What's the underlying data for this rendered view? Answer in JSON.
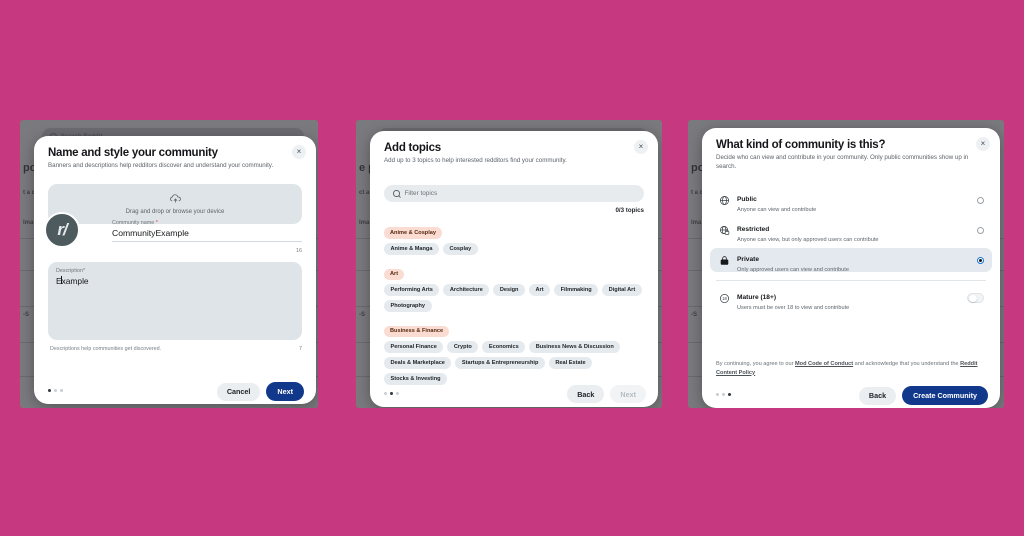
{
  "background_color": "#c6387f",
  "page_background": {
    "search_placeholder": "Search Reddit",
    "fragments": [
      "pc",
      "t a c",
      "Ima",
      "-S"
    ],
    "fragments_p2": [
      "e po",
      "ct a c",
      "Ima",
      "-S"
    ],
    "fragments_p3": [
      "po",
      "t a c",
      "Ima",
      "-S"
    ]
  },
  "panel1": {
    "title": "Name and style your community",
    "subtitle": "Banners and descriptions help redditors discover and understand your community.",
    "close_label": "×",
    "upload": {
      "icon": "upload-cloud-icon",
      "label": "Drag and drop or browse your device"
    },
    "avatar_text": "r/",
    "name_field": {
      "label": "Community name",
      "required_mark": "*",
      "value": "CommunityExample",
      "counter": "16"
    },
    "description_field": {
      "label": "Description",
      "required_mark": "*",
      "value": "Example",
      "counter": "7",
      "helper": "Descriptions help communities get discovered."
    },
    "footer": {
      "cancel_label": "Cancel",
      "next_label": "Next",
      "active_step": 0,
      "steps": 3
    }
  },
  "panel2": {
    "title": "Add topics",
    "subtitle": "Add up to 3 topics to help interested redditors find your community.",
    "close_label": "×",
    "filter": {
      "placeholder": "Filter topics",
      "icon": "search-icon"
    },
    "topic_count": "0/3 topics",
    "categories": [
      {
        "name": "Anime & Cosplay",
        "topics": [
          "Anime & Manga",
          "Cosplay"
        ]
      },
      {
        "name": "Art",
        "topics": [
          "Performing Arts",
          "Architecture",
          "Design",
          "Art",
          "Filmmaking",
          "Digital Art",
          "Photography"
        ]
      },
      {
        "name": "Business & Finance",
        "topics": [
          "Personal Finance",
          "Crypto",
          "Economics",
          "Business News & Discussion",
          "Deals & Marketplace",
          "Startups & Entrepreneurship",
          "Real Estate",
          "Stocks & Investing"
        ]
      }
    ],
    "footer": {
      "back_label": "Back",
      "next_label": "Next",
      "next_disabled": true,
      "active_step": 1,
      "steps": 3
    }
  },
  "panel3": {
    "title": "What kind of community is this?",
    "subtitle": "Decide who can view and contribute in your community. Only public communities show up in search.",
    "close_label": "×",
    "options": [
      {
        "icon": "globe-icon",
        "name": "Public",
        "description": "Anyone can view and contribute",
        "selected": false
      },
      {
        "icon": "globe-lock-icon",
        "name": "Restricted",
        "description": "Anyone can view, but only approved users can contribute",
        "selected": false
      },
      {
        "icon": "lock-icon",
        "name": "Private",
        "description": "Only approved users can view and contribute",
        "selected": true
      }
    ],
    "mature": {
      "icon": "eighteen-plus-icon",
      "name": "Mature (18+)",
      "description": "Users must be over 18 to view and contribute",
      "enabled": false
    },
    "legal": {
      "prefix": "By continuing, you agree to our ",
      "link1": "Mod Code of Conduct",
      "middle": " and acknowledge that you understand the ",
      "link2": "Reddit Content Policy"
    },
    "footer": {
      "back_label": "Back",
      "create_label": "Create Community",
      "active_step": 2,
      "steps": 3
    }
  }
}
